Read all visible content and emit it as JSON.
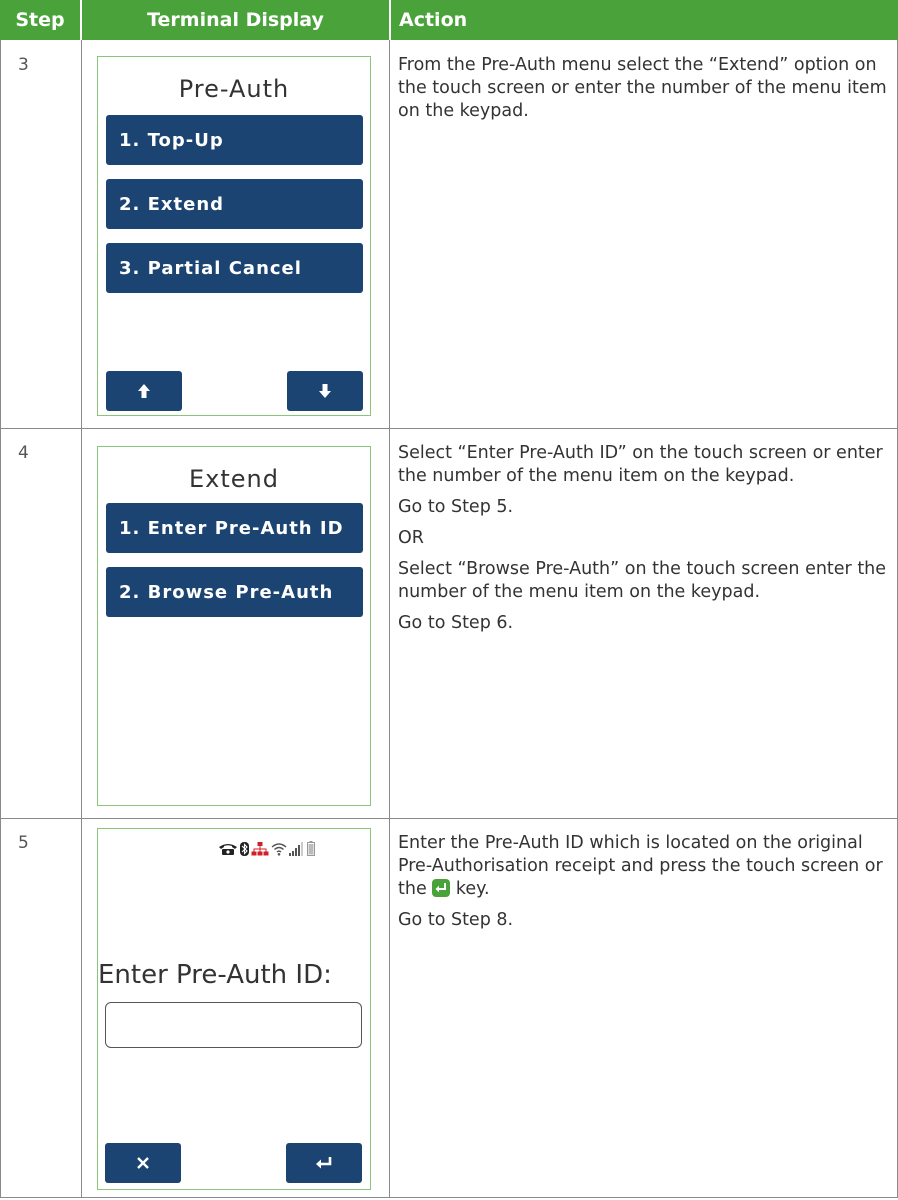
{
  "headers": {
    "step": "Step",
    "terminal": "Terminal Display",
    "action": "Action"
  },
  "rows": [
    {
      "step": "3",
      "screen": {
        "title": "Pre-Auth",
        "menu": [
          "1. Top-Up",
          "2. Extend",
          "3. Partial Cancel"
        ],
        "nav_left_icon": "arrow-up-icon",
        "nav_right_icon": "arrow-down-icon"
      },
      "action": [
        "From the Pre-Auth menu select the “Extend” option on the touch screen or enter the number of the menu item on the keypad."
      ]
    },
    {
      "step": "4",
      "screen": {
        "title": "Extend",
        "menu": [
          "1. Enter Pre-Auth ID",
          "2. Browse Pre-Auth"
        ]
      },
      "action": [
        "Select “Enter Pre-Auth ID” on the touch screen or enter the number of the menu item on the keypad.",
        "Go to Step 5.",
        "OR",
        "Select “Browse Pre-Auth” on the touch screen enter the number of the menu item on the keypad.",
        "Go to Step 6."
      ]
    },
    {
      "step": "5",
      "screen": {
        "prompt": "Enter Pre-Auth ID:",
        "status_icons": [
          "phone-icon",
          "bluetooth-icon",
          "network-icon",
          "wifi-icon",
          "signal-icon",
          "battery-icon"
        ],
        "nav_left_icon": "cancel-x-icon",
        "nav_right_icon": "enter-key-icon"
      },
      "action_part1": "Enter the Pre-Auth ID which is located on the original Pre-Authorisation receipt and press the touch screen or the",
      "action_part2": "key.",
      "action_goto": "Go to Step 8."
    }
  ],
  "colors": {
    "header_green": "#4aa33a",
    "button_blue": "#1b4472",
    "screen_border": "#8cc47a"
  }
}
